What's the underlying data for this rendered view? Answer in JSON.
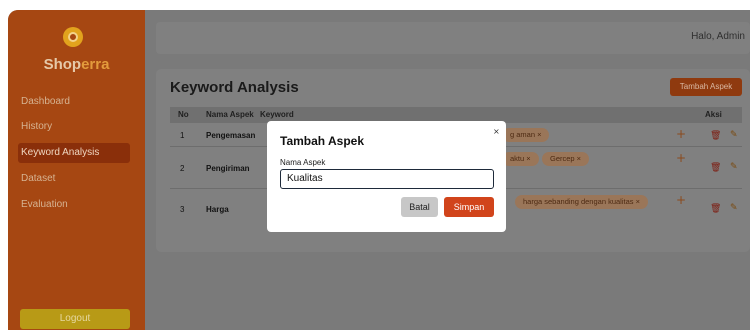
{
  "sidebar": {
    "brand_part1": "Shop",
    "brand_part2": "erra",
    "items": [
      {
        "label": "Dashboard"
      },
      {
        "label": "History"
      },
      {
        "label": "Keyword Analysis"
      },
      {
        "label": "Dataset"
      },
      {
        "label": "Evaluation"
      }
    ],
    "active_item": "Keyword Analysis",
    "logout_label": "Logout"
  },
  "header": {
    "greeting": "Halo, Admin"
  },
  "main": {
    "title": "Keyword Analysis",
    "add_button_label": "Tambah Aspek",
    "columns": [
      "No",
      "Nama Aspek",
      "Keyword",
      "Aksi"
    ],
    "rows": [
      {
        "no": "1",
        "aspect": "Pengemasan",
        "visible_tags": [
          "g aman ×"
        ]
      },
      {
        "no": "2",
        "aspect": "Pengiriman",
        "visible_tags": [
          "aktu ×",
          "Gercep ×"
        ]
      },
      {
        "no": "3",
        "aspect": "Harga",
        "visible_tags": [
          "harga sebanding dengan kualitas ×"
        ]
      }
    ],
    "add_keyword_icon": "plus-icon",
    "delete_icon": "trash-icon",
    "edit_icon": "edit-icon"
  },
  "modal": {
    "title": "Tambah Aspek",
    "close_symbol": "×",
    "field_label": "Nama Aspek",
    "field_value": "Kualitas",
    "cancel_label": "Batal",
    "save_label": "Simpan"
  },
  "colors": {
    "sidebar_bg": "#a64712",
    "accent": "#d1441b",
    "overlay": "#7a7a7a"
  }
}
